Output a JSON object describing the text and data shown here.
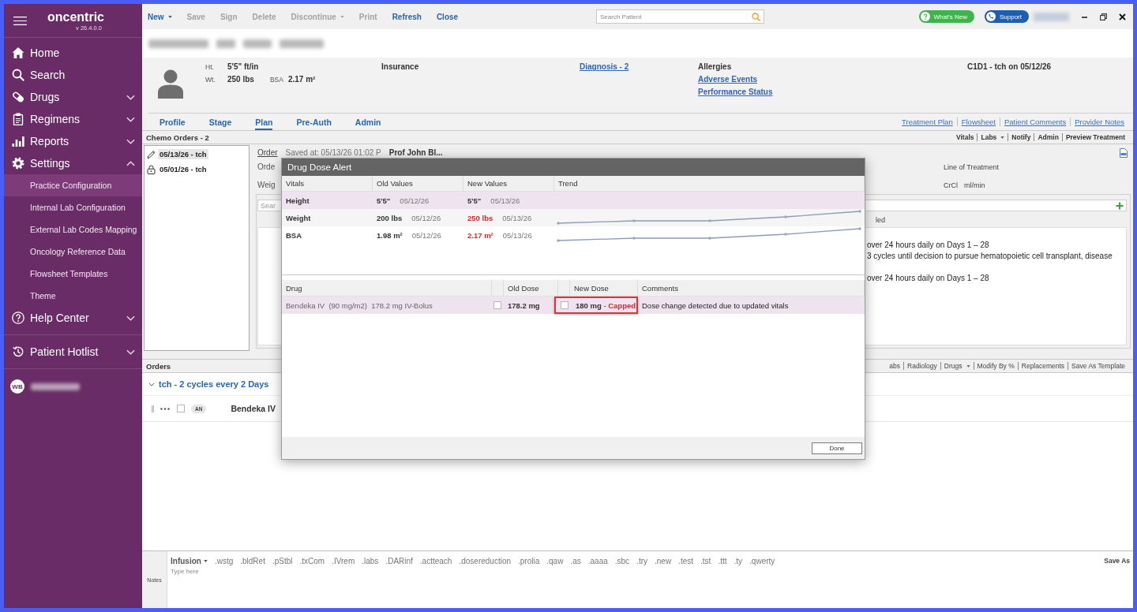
{
  "sidebar": {
    "logo": "oncentric",
    "version": "v 26.4.0.0",
    "items": [
      {
        "label": "Home",
        "kind": "link"
      },
      {
        "label": "Search",
        "kind": "link"
      },
      {
        "label": "Drugs",
        "kind": "group",
        "expanded": false
      },
      {
        "label": "Regimens",
        "kind": "group",
        "expanded": false
      },
      {
        "label": "Reports",
        "kind": "group",
        "expanded": false
      },
      {
        "label": "Settings",
        "kind": "group",
        "expanded": true,
        "children": [
          {
            "label": "Practice Configuration",
            "selected": true
          },
          {
            "label": "Internal Lab Configuration",
            "selected": false
          },
          {
            "label": "External Lab Codes Mapping",
            "selected": false
          },
          {
            "label": "Oncology Reference Data",
            "selected": false
          },
          {
            "label": "Flowsheet Templates",
            "selected": false
          },
          {
            "label": "Theme",
            "selected": false
          }
        ]
      },
      {
        "label": "Help Center",
        "kind": "group",
        "expanded": false
      }
    ],
    "hotlist": {
      "label": "Patient Hotlist",
      "expanded": false
    },
    "user": {
      "initials": "WB"
    }
  },
  "toolbar": {
    "buttons": [
      {
        "label": "New",
        "disabled": false,
        "menu": true
      },
      {
        "label": "Save",
        "disabled": true,
        "menu": false
      },
      {
        "label": "Sign",
        "disabled": true,
        "menu": false
      },
      {
        "label": "Delete",
        "disabled": true,
        "menu": false
      },
      {
        "label": "Discontinue",
        "disabled": true,
        "menu": true
      },
      {
        "label": "Print",
        "disabled": true,
        "menu": false
      },
      {
        "label": "Refresh",
        "disabled": false,
        "menu": false
      },
      {
        "label": "Close",
        "disabled": false,
        "menu": false
      }
    ],
    "search": {
      "placeholder": "Search Patient"
    },
    "whats_new": "What's New",
    "support": "Support"
  },
  "patient": {
    "height_label": "Ht.",
    "height": "5'5\" ft/in",
    "weight_label": "Wt.",
    "weight": "250 lbs",
    "bsa_label": "BSA",
    "bsa": "2.17 m²",
    "insurance_label": "Insurance",
    "diagnosis_link": "Diagnosis - 2",
    "allergies_label": "Allergies",
    "adverse_events_link": "Adverse Events",
    "performance_status_link": "Performance Status",
    "cycle": "C1D1 - tch on 05/12/26"
  },
  "tabs": [
    {
      "label": "Profile",
      "selected": false
    },
    {
      "label": "Stage",
      "selected": false
    },
    {
      "label": "Plan",
      "selected": true
    },
    {
      "label": "Pre-Auth",
      "selected": false
    },
    {
      "label": "Admin",
      "selected": false
    }
  ],
  "quick_links": [
    "Treatment Plan",
    "Flowsheet",
    "Patient Comments",
    "Provider Notes"
  ],
  "chemo_orders": {
    "title": "Chemo Orders - 2",
    "actions": [
      {
        "label": "Vitals",
        "menu": false
      },
      {
        "label": "Labs",
        "menu": true
      },
      {
        "label": "Notify",
        "menu": false
      },
      {
        "label": "Admin",
        "menu": false
      },
      {
        "label": "Preview Treatment",
        "menu": false
      }
    ],
    "orders": [
      {
        "label": "05/13/26 - tch",
        "selected": true,
        "locked": false
      },
      {
        "label": "05/01/26 - tch",
        "selected": false,
        "locked": true
      }
    ],
    "detail": {
      "order_label": "Order",
      "saved": "Saved at: 05/13/26 01:02 P",
      "provider": "Prof John Bl...",
      "row_2_label": "Orde",
      "row_3_label": "Weig",
      "line_of_treatment_label": "Line of Treatment",
      "crcl_label": "CrCl",
      "crcl_unit": "ml/min",
      "search": {
        "placeholder": "Sear"
      },
      "column_label": "led",
      "notes_paragraphs": [
        [
          "over 24 hours daily on Days 1 – 28",
          "3 cycles until decision to pursue hematopoietic cell transplant, disease"
        ],
        [
          "over 24 hours daily on Days 1 – 28"
        ]
      ]
    }
  },
  "orders_section": {
    "title": "Orders",
    "tools": [
      {
        "label": "abs",
        "menu": false
      },
      {
        "label": "Radiology",
        "menu": false
      },
      {
        "label": "Drugs",
        "menu": true
      },
      {
        "label": "Modify By %",
        "menu": false
      },
      {
        "label": "Replacements",
        "menu": false
      },
      {
        "label": "Save As Template",
        "menu": false
      }
    ],
    "group": {
      "title": "tch - 2 cycles every 2 Days",
      "expanded": true,
      "rows": [
        {
          "checked": false,
          "badge": "AN",
          "drug": "Bendeka IV"
        }
      ]
    }
  },
  "notes": {
    "label": "Notes",
    "category": {
      "label": "Infusion",
      "menu": true
    },
    "shortcuts": [
      ".wstg",
      ".bldRet",
      ".pStbl",
      ".txCom",
      ".IVrem",
      ".labs",
      ".DARinf",
      ".actteach",
      ".dosereduction",
      ".prolia",
      ".qaw",
      ".as",
      ".aaaa",
      ".sbc",
      ".try",
      ".new",
      ".test",
      ".tst",
      ".ttt",
      ".ty",
      ".qwerty"
    ],
    "save_as": "Save As",
    "placeholder": "Type here"
  },
  "dialog": {
    "title": "Drug Dose Alert",
    "vitals_columns": [
      "Vitals",
      "Old Values",
      "New Values",
      "Trend"
    ],
    "vitals": [
      {
        "name": "Height",
        "old_value": "5'5\"",
        "old_date": "05/12/26",
        "new_value": "5'5\"",
        "new_date": "05/13/26",
        "changed": false,
        "selected": true
      },
      {
        "name": "Weight",
        "old_value": "200 lbs",
        "old_date": "05/12/26",
        "new_value": "250 lbs",
        "new_date": "05/13/26",
        "changed": true,
        "selected": false
      },
      {
        "name": "BSA",
        "old_value": "1.98 m²",
        "old_date": "05/12/26",
        "new_value": "2.17 m²",
        "new_date": "05/13/26",
        "changed": true,
        "selected": false
      }
    ],
    "drug_columns": [
      "Drug",
      "Old Dose",
      "New Dose",
      "Comments"
    ],
    "drugs": [
      {
        "drug": "Bendeka IV  (90 mg/m2)  178.2 mg IV-Bolus",
        "old_checked": false,
        "old_dose": "178.2 mg",
        "new_checked": false,
        "new_dose": "180 mg",
        "dash": "-",
        "status": "Capped",
        "flagged": true,
        "comment": "Dose change detected due to updated vitals",
        "selected": true
      }
    ],
    "done": "Done"
  }
}
